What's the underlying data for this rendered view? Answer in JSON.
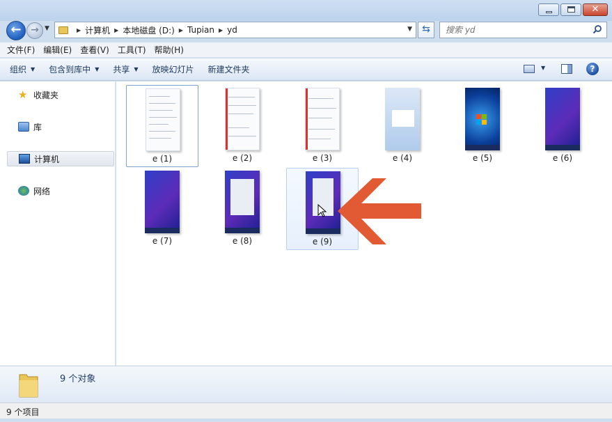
{
  "window": {
    "minimize": "—",
    "maximize": "□",
    "close": "✕"
  },
  "nav": {
    "back": "←",
    "forward": "→",
    "breadcrumb": [
      "计算机",
      "本地磁盘 (D:)",
      "Tupian",
      "yd"
    ],
    "search_placeholder": "搜索 yd"
  },
  "menu": [
    "文件(F)",
    "编辑(E)",
    "查看(V)",
    "工具(T)",
    "帮助(H)"
  ],
  "commands": {
    "organize": "组织",
    "include_library": "包含到库中",
    "share": "共享",
    "slideshow": "放映幻灯片",
    "new_folder": "新建文件夹"
  },
  "sidebar": [
    {
      "label": "收藏夹",
      "icon": "star-icon"
    },
    {
      "label": "库",
      "icon": "library-icon"
    },
    {
      "label": "计算机",
      "icon": "computer-icon",
      "selected": true
    },
    {
      "label": "网络",
      "icon": "network-icon"
    }
  ],
  "files": [
    {
      "name": "e (1)",
      "kind": "doc"
    },
    {
      "name": "e (2)",
      "kind": "doc-red"
    },
    {
      "name": "e (3)",
      "kind": "doc-red"
    },
    {
      "name": "e (4)",
      "kind": "blue"
    },
    {
      "name": "e (5)",
      "kind": "win"
    },
    {
      "name": "e (6)",
      "kind": "purple"
    },
    {
      "name": "e (7)",
      "kind": "purple"
    },
    {
      "name": "e (8)",
      "kind": "purple-doc"
    },
    {
      "name": "e (9)",
      "kind": "purple-doc"
    }
  ],
  "details": {
    "count_text": "9 个对象"
  },
  "status": {
    "text": "9 个项目"
  }
}
